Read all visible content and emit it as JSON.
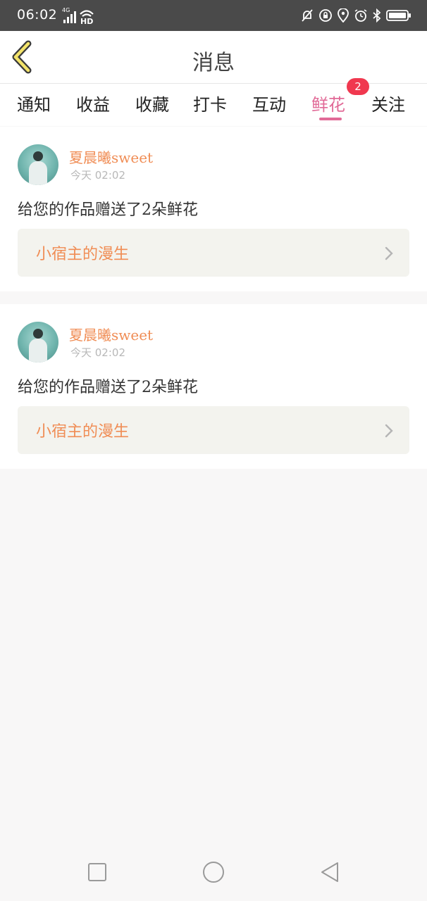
{
  "status_bar": {
    "time": "06:02",
    "network": "4G",
    "hd": "HD"
  },
  "header": {
    "title": "消息"
  },
  "tabs": [
    {
      "label": "通知"
    },
    {
      "label": "收益"
    },
    {
      "label": "收藏"
    },
    {
      "label": "打卡"
    },
    {
      "label": "互动"
    },
    {
      "label": "鲜花",
      "active": true,
      "badge": "2"
    },
    {
      "label": "关注"
    }
  ],
  "messages": [
    {
      "sender": "夏晨曦sweet",
      "time": "今天 02:02",
      "text": "给您的作品赠送了2朵鲜花",
      "work_title": "小宿主的漫生"
    },
    {
      "sender": "夏晨曦sweet",
      "time": "今天 02:02",
      "text": "给您的作品赠送了2朵鲜花",
      "work_title": "小宿主的漫生"
    }
  ],
  "colors": {
    "accent_pink": "#e16a97",
    "accent_orange": "#f08d55",
    "badge_red": "#f0384f"
  }
}
